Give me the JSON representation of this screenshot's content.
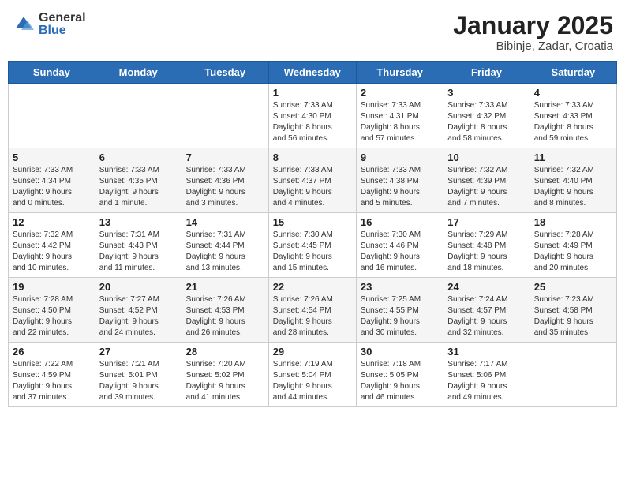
{
  "logo": {
    "general": "General",
    "blue": "Blue"
  },
  "title": "January 2025",
  "subtitle": "Bibinje, Zadar, Croatia",
  "weekdays": [
    "Sunday",
    "Monday",
    "Tuesday",
    "Wednesday",
    "Thursday",
    "Friday",
    "Saturday"
  ],
  "weeks": [
    [
      {
        "day": "",
        "info": ""
      },
      {
        "day": "",
        "info": ""
      },
      {
        "day": "",
        "info": ""
      },
      {
        "day": "1",
        "info": "Sunrise: 7:33 AM\nSunset: 4:30 PM\nDaylight: 8 hours\nand 56 minutes."
      },
      {
        "day": "2",
        "info": "Sunrise: 7:33 AM\nSunset: 4:31 PM\nDaylight: 8 hours\nand 57 minutes."
      },
      {
        "day": "3",
        "info": "Sunrise: 7:33 AM\nSunset: 4:32 PM\nDaylight: 8 hours\nand 58 minutes."
      },
      {
        "day": "4",
        "info": "Sunrise: 7:33 AM\nSunset: 4:33 PM\nDaylight: 8 hours\nand 59 minutes."
      }
    ],
    [
      {
        "day": "5",
        "info": "Sunrise: 7:33 AM\nSunset: 4:34 PM\nDaylight: 9 hours\nand 0 minutes."
      },
      {
        "day": "6",
        "info": "Sunrise: 7:33 AM\nSunset: 4:35 PM\nDaylight: 9 hours\nand 1 minute."
      },
      {
        "day": "7",
        "info": "Sunrise: 7:33 AM\nSunset: 4:36 PM\nDaylight: 9 hours\nand 3 minutes."
      },
      {
        "day": "8",
        "info": "Sunrise: 7:33 AM\nSunset: 4:37 PM\nDaylight: 9 hours\nand 4 minutes."
      },
      {
        "day": "9",
        "info": "Sunrise: 7:33 AM\nSunset: 4:38 PM\nDaylight: 9 hours\nand 5 minutes."
      },
      {
        "day": "10",
        "info": "Sunrise: 7:32 AM\nSunset: 4:39 PM\nDaylight: 9 hours\nand 7 minutes."
      },
      {
        "day": "11",
        "info": "Sunrise: 7:32 AM\nSunset: 4:40 PM\nDaylight: 9 hours\nand 8 minutes."
      }
    ],
    [
      {
        "day": "12",
        "info": "Sunrise: 7:32 AM\nSunset: 4:42 PM\nDaylight: 9 hours\nand 10 minutes."
      },
      {
        "day": "13",
        "info": "Sunrise: 7:31 AM\nSunset: 4:43 PM\nDaylight: 9 hours\nand 11 minutes."
      },
      {
        "day": "14",
        "info": "Sunrise: 7:31 AM\nSunset: 4:44 PM\nDaylight: 9 hours\nand 13 minutes."
      },
      {
        "day": "15",
        "info": "Sunrise: 7:30 AM\nSunset: 4:45 PM\nDaylight: 9 hours\nand 15 minutes."
      },
      {
        "day": "16",
        "info": "Sunrise: 7:30 AM\nSunset: 4:46 PM\nDaylight: 9 hours\nand 16 minutes."
      },
      {
        "day": "17",
        "info": "Sunrise: 7:29 AM\nSunset: 4:48 PM\nDaylight: 9 hours\nand 18 minutes."
      },
      {
        "day": "18",
        "info": "Sunrise: 7:28 AM\nSunset: 4:49 PM\nDaylight: 9 hours\nand 20 minutes."
      }
    ],
    [
      {
        "day": "19",
        "info": "Sunrise: 7:28 AM\nSunset: 4:50 PM\nDaylight: 9 hours\nand 22 minutes."
      },
      {
        "day": "20",
        "info": "Sunrise: 7:27 AM\nSunset: 4:52 PM\nDaylight: 9 hours\nand 24 minutes."
      },
      {
        "day": "21",
        "info": "Sunrise: 7:26 AM\nSunset: 4:53 PM\nDaylight: 9 hours\nand 26 minutes."
      },
      {
        "day": "22",
        "info": "Sunrise: 7:26 AM\nSunset: 4:54 PM\nDaylight: 9 hours\nand 28 minutes."
      },
      {
        "day": "23",
        "info": "Sunrise: 7:25 AM\nSunset: 4:55 PM\nDaylight: 9 hours\nand 30 minutes."
      },
      {
        "day": "24",
        "info": "Sunrise: 7:24 AM\nSunset: 4:57 PM\nDaylight: 9 hours\nand 32 minutes."
      },
      {
        "day": "25",
        "info": "Sunrise: 7:23 AM\nSunset: 4:58 PM\nDaylight: 9 hours\nand 35 minutes."
      }
    ],
    [
      {
        "day": "26",
        "info": "Sunrise: 7:22 AM\nSunset: 4:59 PM\nDaylight: 9 hours\nand 37 minutes."
      },
      {
        "day": "27",
        "info": "Sunrise: 7:21 AM\nSunset: 5:01 PM\nDaylight: 9 hours\nand 39 minutes."
      },
      {
        "day": "28",
        "info": "Sunrise: 7:20 AM\nSunset: 5:02 PM\nDaylight: 9 hours\nand 41 minutes."
      },
      {
        "day": "29",
        "info": "Sunrise: 7:19 AM\nSunset: 5:04 PM\nDaylight: 9 hours\nand 44 minutes."
      },
      {
        "day": "30",
        "info": "Sunrise: 7:18 AM\nSunset: 5:05 PM\nDaylight: 9 hours\nand 46 minutes."
      },
      {
        "day": "31",
        "info": "Sunrise: 7:17 AM\nSunset: 5:06 PM\nDaylight: 9 hours\nand 49 minutes."
      },
      {
        "day": "",
        "info": ""
      }
    ]
  ]
}
